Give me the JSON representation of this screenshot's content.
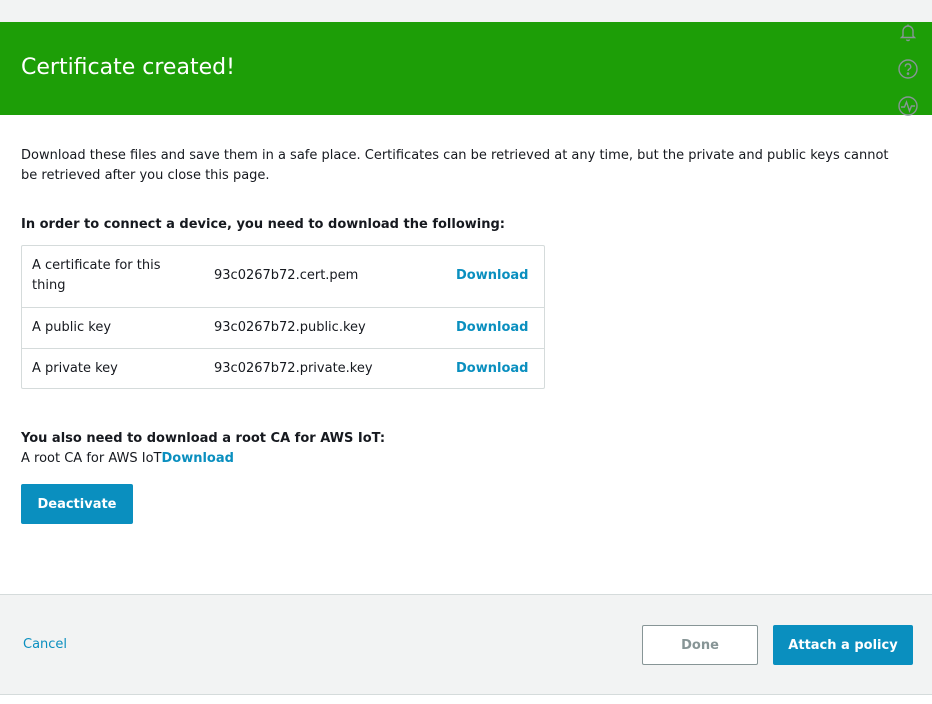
{
  "banner": {
    "title": "Certificate created!"
  },
  "side_icons": [
    "bell-icon",
    "help-circle-icon",
    "activity-icon"
  ],
  "intro_text": "Download these files and save them in a safe place. Certificates can be retrieved at any time, but the private and public keys cannot be retrieved after you close this page.",
  "connect_heading": "In order to connect a device, you need to download the following:",
  "files": [
    {
      "label": "A certificate for this thing",
      "file": "93c0267b72.cert.pem",
      "action": "Download"
    },
    {
      "label": "A public key",
      "file": "93c0267b72.public.key",
      "action": "Download"
    },
    {
      "label": "A private key",
      "file": "93c0267b72.private.key",
      "action": "Download"
    }
  ],
  "root_ca": {
    "heading": "You also need to download a root CA for AWS IoT:",
    "label": "A root CA for AWS IoT",
    "action": "Download"
  },
  "deactivate_label": "Deactivate",
  "footer": {
    "cancel_label": "Cancel",
    "done_label": "Done",
    "attach_label": "Attach a policy"
  },
  "colors": {
    "banner": "#1d9e07",
    "primary": "#0a8fbf",
    "link": "#0a8fbf",
    "border": "#d5dbdb",
    "footer_bg": "#f2f3f3"
  }
}
